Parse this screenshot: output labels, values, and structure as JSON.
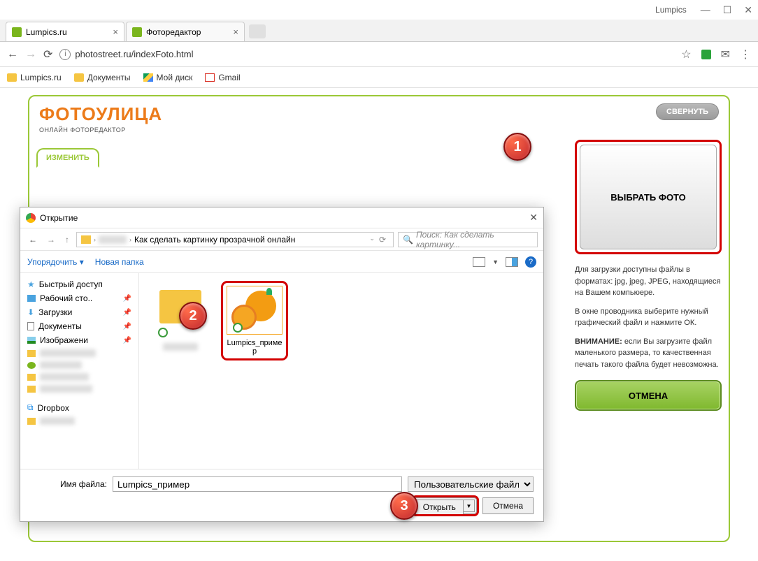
{
  "window": {
    "title": "Lumpics"
  },
  "tabs": [
    {
      "title": "Lumpics.ru"
    },
    {
      "title": "Фоторедактор"
    }
  ],
  "address": {
    "url": "photostreet.ru/indexFoto.html"
  },
  "bookmarks": [
    {
      "label": "Lumpics.ru"
    },
    {
      "label": "Документы"
    },
    {
      "label": "Мой диск"
    },
    {
      "label": "Gmail"
    }
  ],
  "app": {
    "logo_main": "ФОТОУЛИЦА",
    "logo_sub": "ОНЛАЙН ФОТОРЕДАКТОР",
    "collapse": "СВЕРНУТЬ",
    "change_tab": "ИЗМЕНИТЬ",
    "select_photo": "ВЫБРАТЬ ФОТО",
    "hint1": "Для загрузки доступны файлы в форматах: jpg, jpeg, JPEG, находящиеся на Вашем компьюере.",
    "hint2": "В окне проводника выберите нужный графический файл и нажмите ОК.",
    "hint3_prefix": "ВНИМАНИЕ:",
    "hint3_rest": " если Вы загрузите файл маленького размера, то качественная печать такого файла будет невозможна.",
    "cancel_btn": "ОТМЕНА"
  },
  "dialog": {
    "title": "Открытие",
    "path_folder": "Как сделать картинку прозрачной онлайн",
    "search_placeholder": "Поиск: Как сделать картинку...",
    "organize": "Упорядочить",
    "new_folder": "Новая папка",
    "sidebar": {
      "quick": "Быстрый доступ",
      "desktop": "Рабочий сто..",
      "downloads": "Загрузки",
      "documents": "Документы",
      "images": "Изображени",
      "dropbox": "Dropbox"
    },
    "file_name_label": "Имя файла:",
    "file_name_value": "Lumpics_пример",
    "file_type": "Пользовательские файлы",
    "open_btn": "Открыть",
    "cancel_btn": "Отмена",
    "selected_file": "Lumpics_пример"
  },
  "badges": {
    "b1": "1",
    "b2": "2",
    "b3": "3"
  }
}
